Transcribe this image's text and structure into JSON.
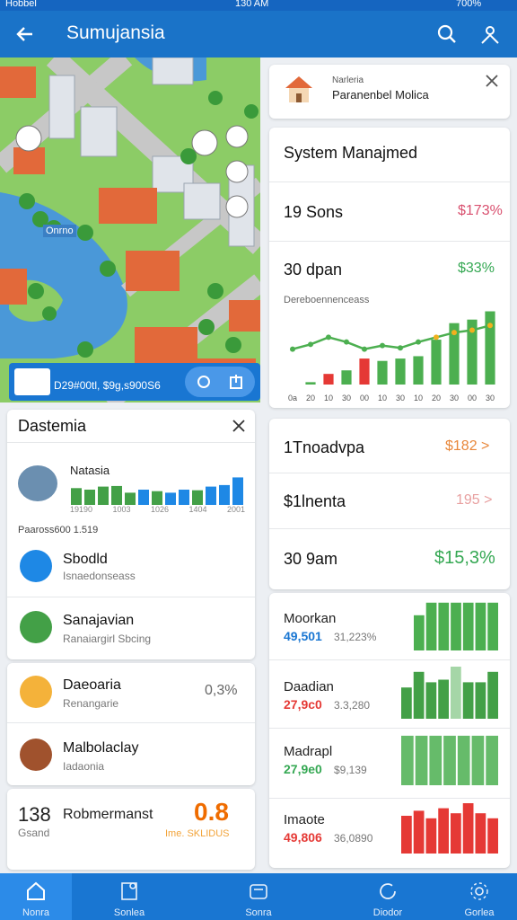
{
  "status": {
    "left": "Hobbel",
    "time": "130 AM",
    "battery": "700%"
  },
  "appbar": {
    "title": "Sumujansia"
  },
  "map": {
    "lake_label": "Onrno",
    "footer_text": "D29#00tl, $9g,s900S6"
  },
  "notification": {
    "line1": "Narleria",
    "line2": "Paranenbel Molica"
  },
  "system_card": {
    "title": "System Manajmed",
    "rows": [
      {
        "label": "19 Sons",
        "value": "$173%",
        "color": "#d9506f"
      },
      {
        "label": "30 dpan",
        "value": "$33%",
        "color": "#35a853"
      }
    ],
    "chart_title": "Dereboennenceass"
  },
  "chart_data": {
    "type": "bar",
    "xticks": [
      "0a",
      "20",
      "10",
      "30",
      "00",
      "10",
      "30",
      "10",
      "20",
      "30",
      "00",
      "30"
    ],
    "values": [
      0,
      2,
      9,
      12,
      22,
      20,
      22,
      24,
      38,
      52,
      55,
      62
    ],
    "bar_colors": [
      "#4caf50",
      "#4caf50",
      "#e53935",
      "#4caf50",
      "#e53935",
      "#4caf50",
      "#4caf50",
      "#4caf50",
      "#4caf50",
      "#4caf50",
      "#4caf50",
      "#4caf50"
    ],
    "line": [
      30,
      34,
      40,
      36,
      30,
      33,
      31,
      36,
      40,
      44,
      46,
      50
    ]
  },
  "left_card": {
    "title": "Dastemia",
    "item1_title": "Natasia",
    "item1_ticks": [
      "19190",
      "1003",
      "1026",
      "1404",
      "2001"
    ],
    "section_label": "Paaross600 1.519",
    "items": [
      {
        "title": "Sbodld",
        "sub": "Isnaedonseass"
      },
      {
        "title": "Sanajavian",
        "sub": "Ranaiargirl Sbcing"
      }
    ]
  },
  "left_card2": {
    "items": [
      {
        "title": "Daeoaria",
        "sub": "Renangarie",
        "value": "0,3%"
      },
      {
        "title": "Malbolaclay",
        "sub": "Iadaonia"
      }
    ]
  },
  "left_card3": {
    "value": "138",
    "title": "Robmermanst",
    "sub": "Gsand",
    "badge": "0.8",
    "badge_sub": "Ime. SKLIDUS"
  },
  "right_list": [
    {
      "label": "1Tnoadvpa",
      "value": "$182 >",
      "color": "#e8873a"
    },
    {
      "label": "$1lnenta",
      "value": "195 >",
      "color": "#e8a0a0"
    },
    {
      "label": "30 9am",
      "value": "$15,3%",
      "color": "#35a853"
    }
  ],
  "right_charts": [
    {
      "title": "Moorkan",
      "num": "49,501",
      "num_color": "#1976d2",
      "sub": "31,223%",
      "bars": [
        0.7,
        0.95,
        0.95,
        0.95,
        0.95,
        0.95,
        0.95
      ],
      "color": "#4caf50"
    },
    {
      "title": "Daadian",
      "num": "27,9c0",
      "num_color": "#e53935",
      "sub": "3.3,280",
      "bars": [
        0.6,
        0.9,
        0.7,
        0.75,
        1.0,
        0.7,
        0.7,
        0.9
      ],
      "color": "#43a047"
    },
    {
      "title": "Madrapl",
      "num": "27,9e0",
      "num_color": "#35a853",
      "sub": "$9,139",
      "bars": [
        0.95,
        0.95,
        0.95,
        0.95,
        0.95,
        0.95,
        0.95
      ],
      "color": "#66bb6a"
    },
    {
      "title": "Imaote",
      "num": "49,806",
      "num_color": "#e53935",
      "sub": "36,0890",
      "bars": [
        0.75,
        0.85,
        0.7,
        0.9,
        0.8,
        1.0,
        0.8,
        0.7
      ],
      "color": "#e53935"
    }
  ],
  "bottom_nav": [
    "Nonra",
    "Sonlea",
    "Sonra",
    "Diodor",
    "Gorlea"
  ]
}
